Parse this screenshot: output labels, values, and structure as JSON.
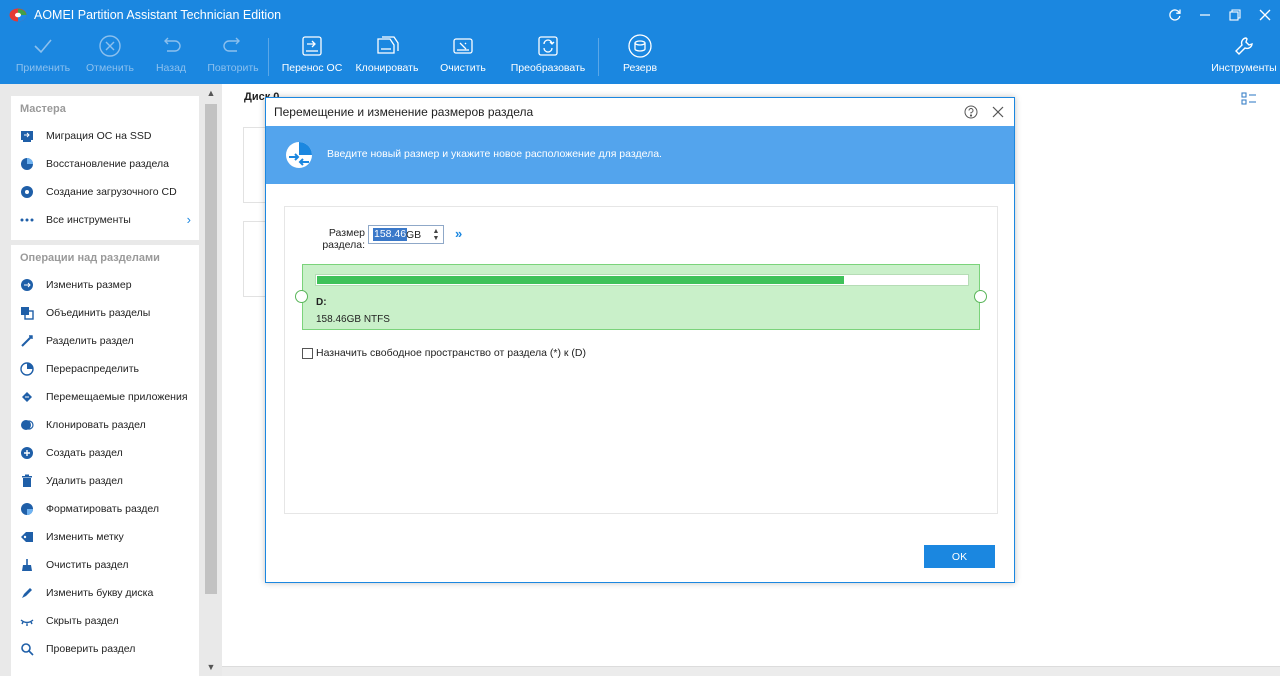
{
  "window": {
    "title": "AOMEI Partition Assistant Technician Edition",
    "accent_color": "#1b87e0",
    "controls": [
      "refresh-icon",
      "minimize-icon",
      "restore-icon",
      "close-icon"
    ]
  },
  "toolbar": {
    "apply": "Применить",
    "discard": "Отменить",
    "undo": "Назад",
    "redo": "Повторить",
    "migrate_os": "Перенос ОС",
    "clone": "Клонировать",
    "wipe": "Очистить",
    "convert": "Преобразовать",
    "backup": "Резерв",
    "tools": "Инструменты"
  },
  "sidebar": {
    "wizards_title": "Мастера",
    "wizards": [
      {
        "label": "Миграция ОС на SSD",
        "icon": "migrate-os-icon"
      },
      {
        "label": "Восстановление раздела",
        "icon": "recovery-icon"
      },
      {
        "label": "Создание загрузочного CD",
        "icon": "bootable-cd-icon"
      },
      {
        "label": "Все инструменты",
        "icon": "more-icon"
      }
    ],
    "operations_title": "Операции над разделами",
    "operations": [
      {
        "label": "Изменить размер",
        "icon": "resize-icon"
      },
      {
        "label": "Объединить разделы",
        "icon": "merge-icon"
      },
      {
        "label": "Разделить раздел",
        "icon": "split-icon"
      },
      {
        "label": "Перераспределить",
        "icon": "allocate-icon"
      },
      {
        "label": "Перемещаемые приложения",
        "icon": "app-mover-icon"
      },
      {
        "label": "Клонировать раздел",
        "icon": "clone-partition-icon"
      },
      {
        "label": "Создать раздел",
        "icon": "create-partition-icon"
      },
      {
        "label": "Удалить раздел",
        "icon": "delete-icon"
      },
      {
        "label": "Форматировать раздел",
        "icon": "format-icon"
      },
      {
        "label": "Изменить метку",
        "icon": "label-icon"
      },
      {
        "label": "Очистить раздел",
        "icon": "wipe-icon"
      },
      {
        "label": "Изменить букву диска",
        "icon": "drive-letter-icon"
      },
      {
        "label": "Скрыть раздел",
        "icon": "hide-icon"
      },
      {
        "label": "Проверить раздел",
        "icon": "check-icon"
      }
    ]
  },
  "main": {
    "disk_label": "Диск 0"
  },
  "dialog": {
    "title": "Перемещение и изменение размеров раздела",
    "banner_text": "Введите новый размер и укажите новое расположение для раздела.",
    "size_label": "Размер раздела:",
    "size_value": "158.46",
    "size_unit": "GB",
    "partition_name": "D:",
    "partition_info": "158.46GB NTFS",
    "used_fraction": 0.81,
    "checkbox_label": "Назначить свободное пространство от раздела (*) к (D)",
    "checkbox_checked": false,
    "ok_label": "OK"
  }
}
